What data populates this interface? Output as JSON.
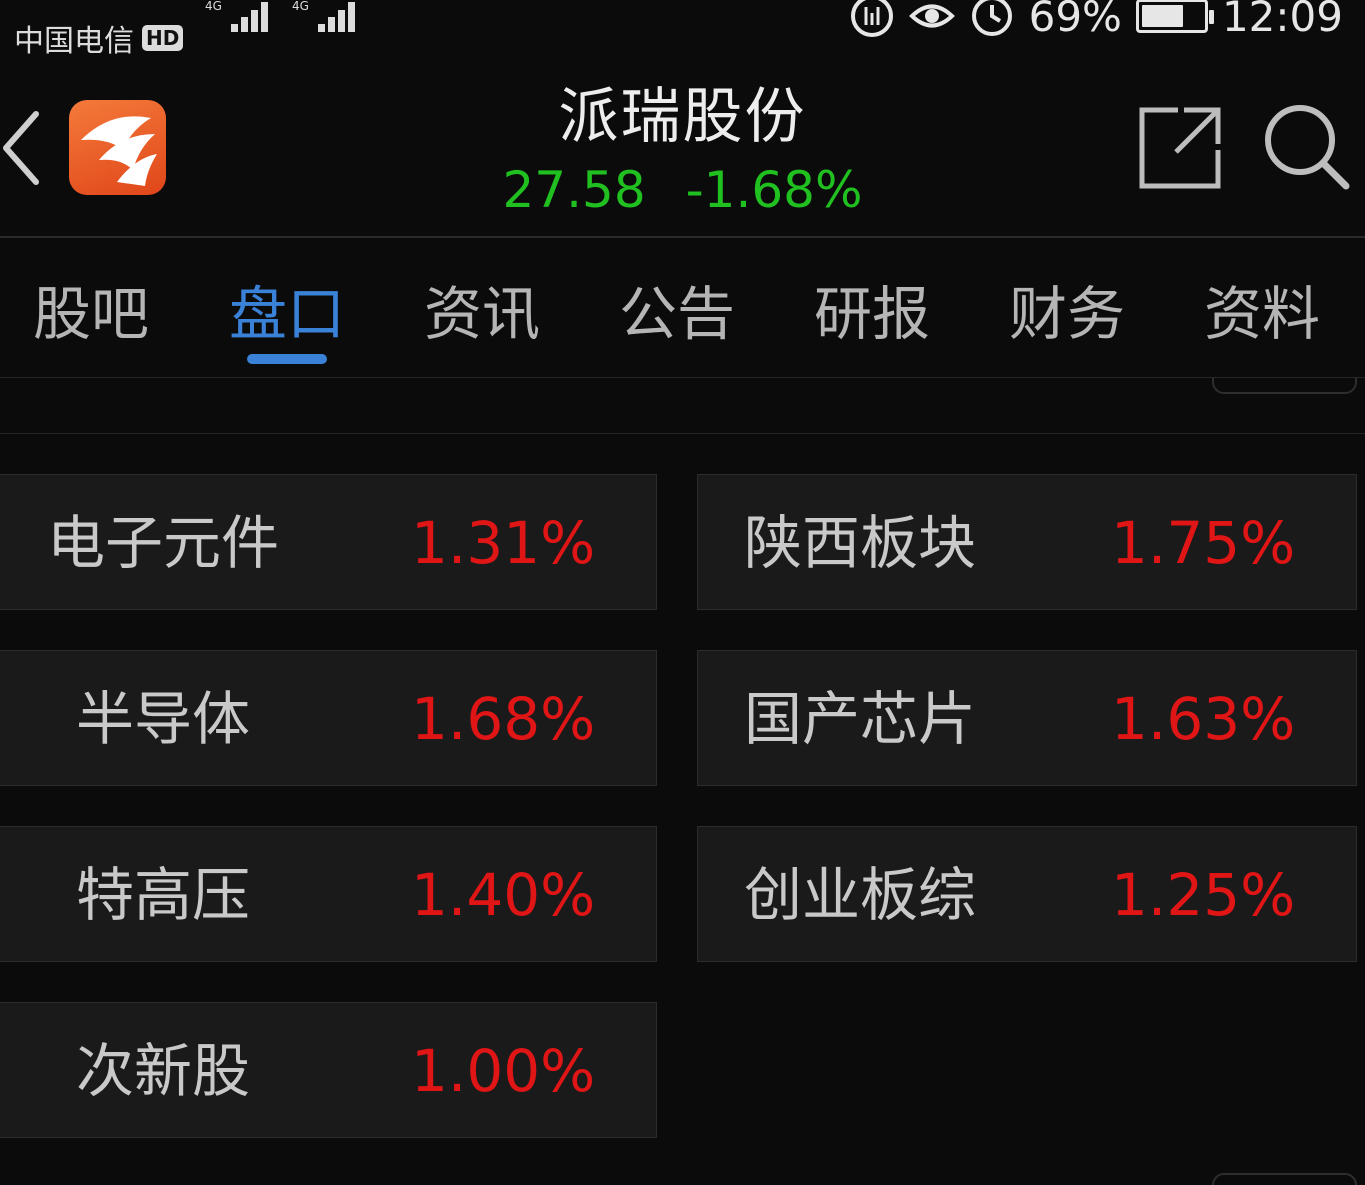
{
  "status_bar": {
    "carrier": "中国电信",
    "hd_badge": "HD",
    "network_type": "4G",
    "battery_percent": 69,
    "battery_text": "69%",
    "time": "12:09"
  },
  "header": {
    "back_icon": "chevron-left-icon",
    "logo_icon": "app-logo",
    "stock_name": "派瑞股份",
    "price": "27.58",
    "change_percent": "-1.68%",
    "price_color": "#20c020",
    "share_icon": "share-external-icon",
    "search_icon": "search-icon"
  },
  "tabs": [
    {
      "label": "股吧",
      "active": false
    },
    {
      "label": "盘口",
      "active": true
    },
    {
      "label": "资讯",
      "active": false
    },
    {
      "label": "公告",
      "active": false
    },
    {
      "label": "研报",
      "active": false
    },
    {
      "label": "财务",
      "active": false
    },
    {
      "label": "资料",
      "active": false
    }
  ],
  "accent_color": "#3a82d8",
  "up_color": "#e01515",
  "sectors": [
    {
      "name": "电子元件",
      "change": "1.31%"
    },
    {
      "name": "陕西板块",
      "change": "1.75%"
    },
    {
      "name": "半导体",
      "change": "1.68%"
    },
    {
      "name": "国产芯片",
      "change": "1.63%"
    },
    {
      "name": "特高压",
      "change": "1.40%"
    },
    {
      "name": "创业板综",
      "change": "1.25%"
    },
    {
      "name": "次新股",
      "change": "1.00%"
    }
  ]
}
